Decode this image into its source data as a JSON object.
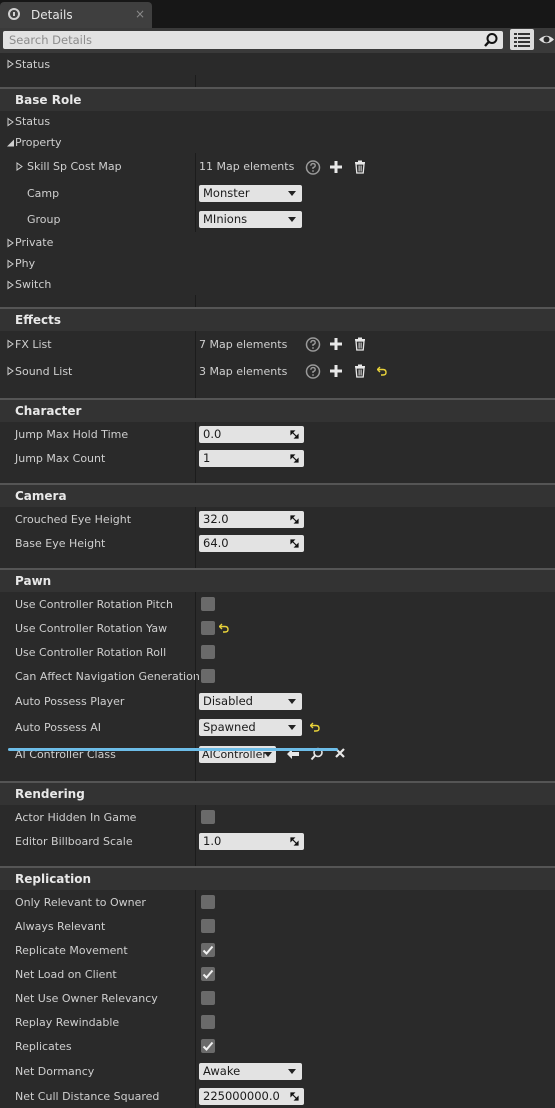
{
  "tab": {
    "title": "Details",
    "close": "×"
  },
  "search": {
    "placeholder": "Search Details"
  },
  "top_status": "Status",
  "base_role": {
    "title": "Base Role",
    "status": "Status",
    "property": "Property",
    "skill_map_label": "Skill Sp Cost Map",
    "skill_map_count": "11 Map elements",
    "camp_label": "Camp",
    "camp_value": "Monster",
    "group_label": "Group",
    "group_value": "MInions",
    "private": "Private",
    "phy": "Phy",
    "switch": "Switch"
  },
  "effects": {
    "title": "Effects",
    "fx_label": "FX List",
    "fx_count": "7 Map elements",
    "sound_label": "Sound List",
    "sound_count": "3 Map elements"
  },
  "character": {
    "title": "Character",
    "jump_hold_label": "Jump Max Hold Time",
    "jump_hold_value": "0.0",
    "jump_count_label": "Jump Max Count",
    "jump_count_value": "1"
  },
  "camera": {
    "title": "Camera",
    "crouched_label": "Crouched Eye Height",
    "crouched_value": "32.0",
    "base_eye_label": "Base Eye Height",
    "base_eye_value": "64.0"
  },
  "pawn": {
    "title": "Pawn",
    "pitch_label": "Use Controller Rotation Pitch",
    "yaw_label": "Use Controller Rotation Yaw",
    "roll_label": "Use Controller Rotation Roll",
    "nav_label": "Can Affect Navigation Generation",
    "possess_player_label": "Auto Possess Player",
    "possess_player_value": "Disabled",
    "possess_ai_label": "Auto Possess AI",
    "possess_ai_value": "Spawned",
    "ai_class_label": "AI Controller Class",
    "ai_class_value": "AIController"
  },
  "rendering": {
    "title": "Rendering",
    "hidden_label": "Actor Hidden In Game",
    "billboard_label": "Editor Billboard Scale",
    "billboard_value": "1.0"
  },
  "replication": {
    "title": "Replication",
    "owner_label": "Only Relevant to Owner",
    "always_label": "Always Relevant",
    "movement_label": "Replicate Movement",
    "netload_label": "Net Load on Client",
    "ownerrel_label": "Net Use Owner Relevancy",
    "rewind_label": "Replay Rewindable",
    "replicates_label": "Replicates",
    "dormancy_label": "Net Dormancy",
    "dormancy_value": "Awake",
    "cull_label": "Net Cull Distance Squared",
    "cull_value": "225000000.0"
  },
  "colors": {
    "accent_line": "#6dbde8",
    "reset_arrow": "#e8d23a"
  }
}
